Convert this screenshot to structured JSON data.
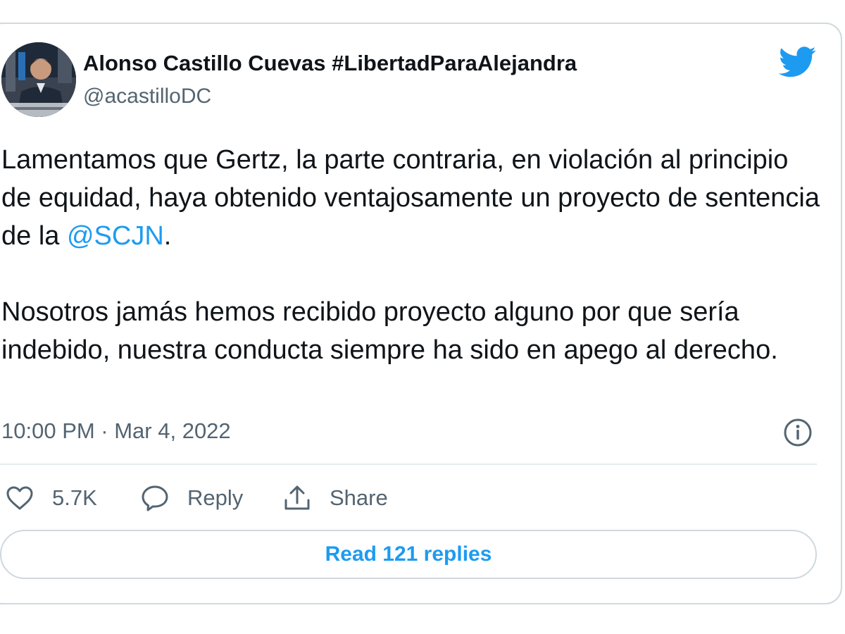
{
  "author": {
    "display_name": "Alonso Castillo Cuevas #LibertadParaAlejandra",
    "handle": "@acastilloDC"
  },
  "tweet": {
    "paragraph1_part1": "Lamentamos que Gertz, la parte contraria, en violación al principio de equidad, haya obtenido ventajosamente un proyecto de sentencia de la ",
    "paragraph1_mention": "@SCJN",
    "paragraph1_part2": ".",
    "paragraph2": "Nosotros jamás hemos recibido proyecto alguno por que sería indebido, nuestra conducta siempre ha sido en apego al derecho.",
    "timestamp": "10:00 PM · Mar 4, 2022"
  },
  "actions": {
    "like_count": "5.7K",
    "reply_label": "Reply",
    "share_label": "Share"
  },
  "read_replies_label": "Read 121 replies",
  "icons": {
    "brand": "twitter-bird-icon",
    "info": "info-icon",
    "like": "heart-icon",
    "reply": "speech-bubble-icon",
    "share": "share-icon"
  },
  "colors": {
    "accent": "#1d9bf0",
    "text_primary": "#0f1419",
    "text_secondary": "#536471",
    "border": "#cfd9de"
  }
}
